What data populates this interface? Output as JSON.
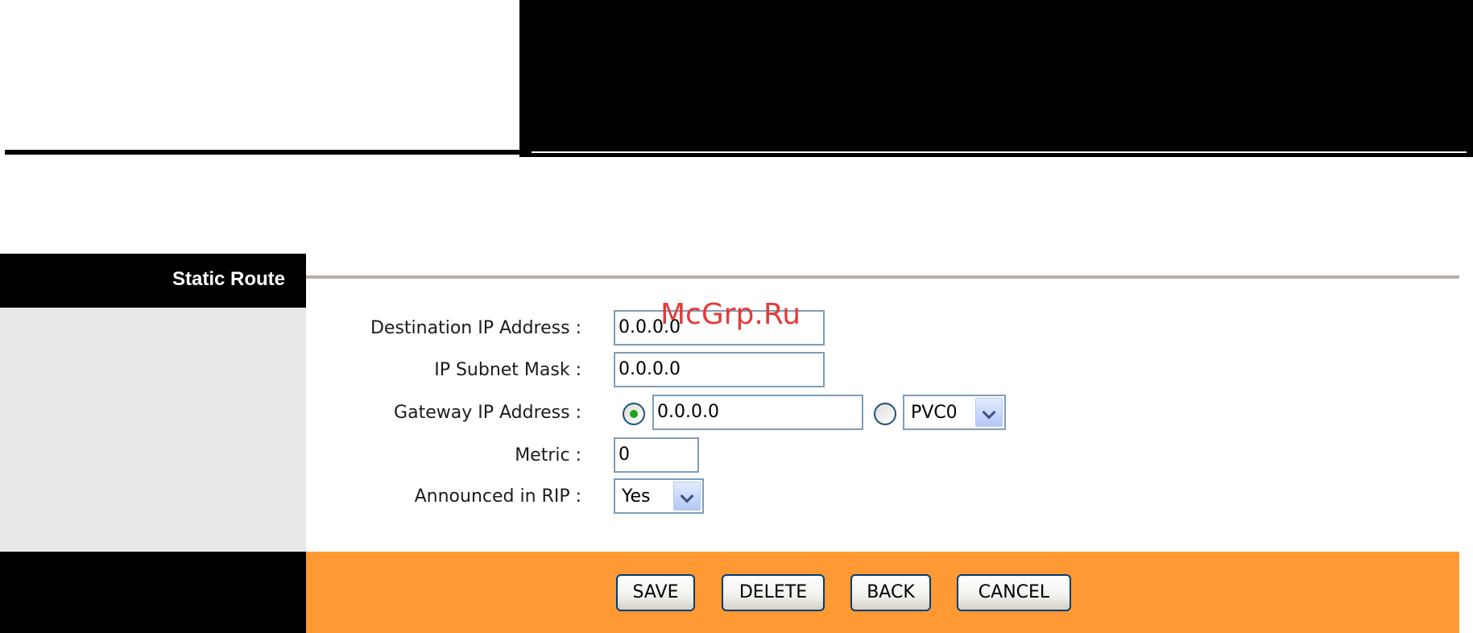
{
  "section": {
    "title": "Static Route"
  },
  "form": {
    "destination_ip": {
      "label": "Destination IP Address :",
      "value": "0.0.0.0"
    },
    "subnet_mask": {
      "label": "IP Subnet Mask :",
      "value": "0.0.0.0"
    },
    "gateway": {
      "label": "Gateway IP Address :",
      "ip_value": "0.0.0.0",
      "ip_radio_checked": true,
      "interface_radio_checked": false,
      "interface_selected": "PVC0"
    },
    "metric": {
      "label": "Metric :",
      "value": "0"
    },
    "announced_rip": {
      "label": "Announced in RIP :",
      "selected": "Yes"
    }
  },
  "actions": {
    "save": "SAVE",
    "delete": "DELETE",
    "back": "BACK",
    "cancel": "CANCEL"
  },
  "watermark": "McGrp.Ru",
  "colors": {
    "action_bar": "#ff9933",
    "sidebar_gray": "#e8e8e8",
    "title_rule": "#b5afa6",
    "field_border": "#7f9db9",
    "watermark": "#e23b3b"
  }
}
